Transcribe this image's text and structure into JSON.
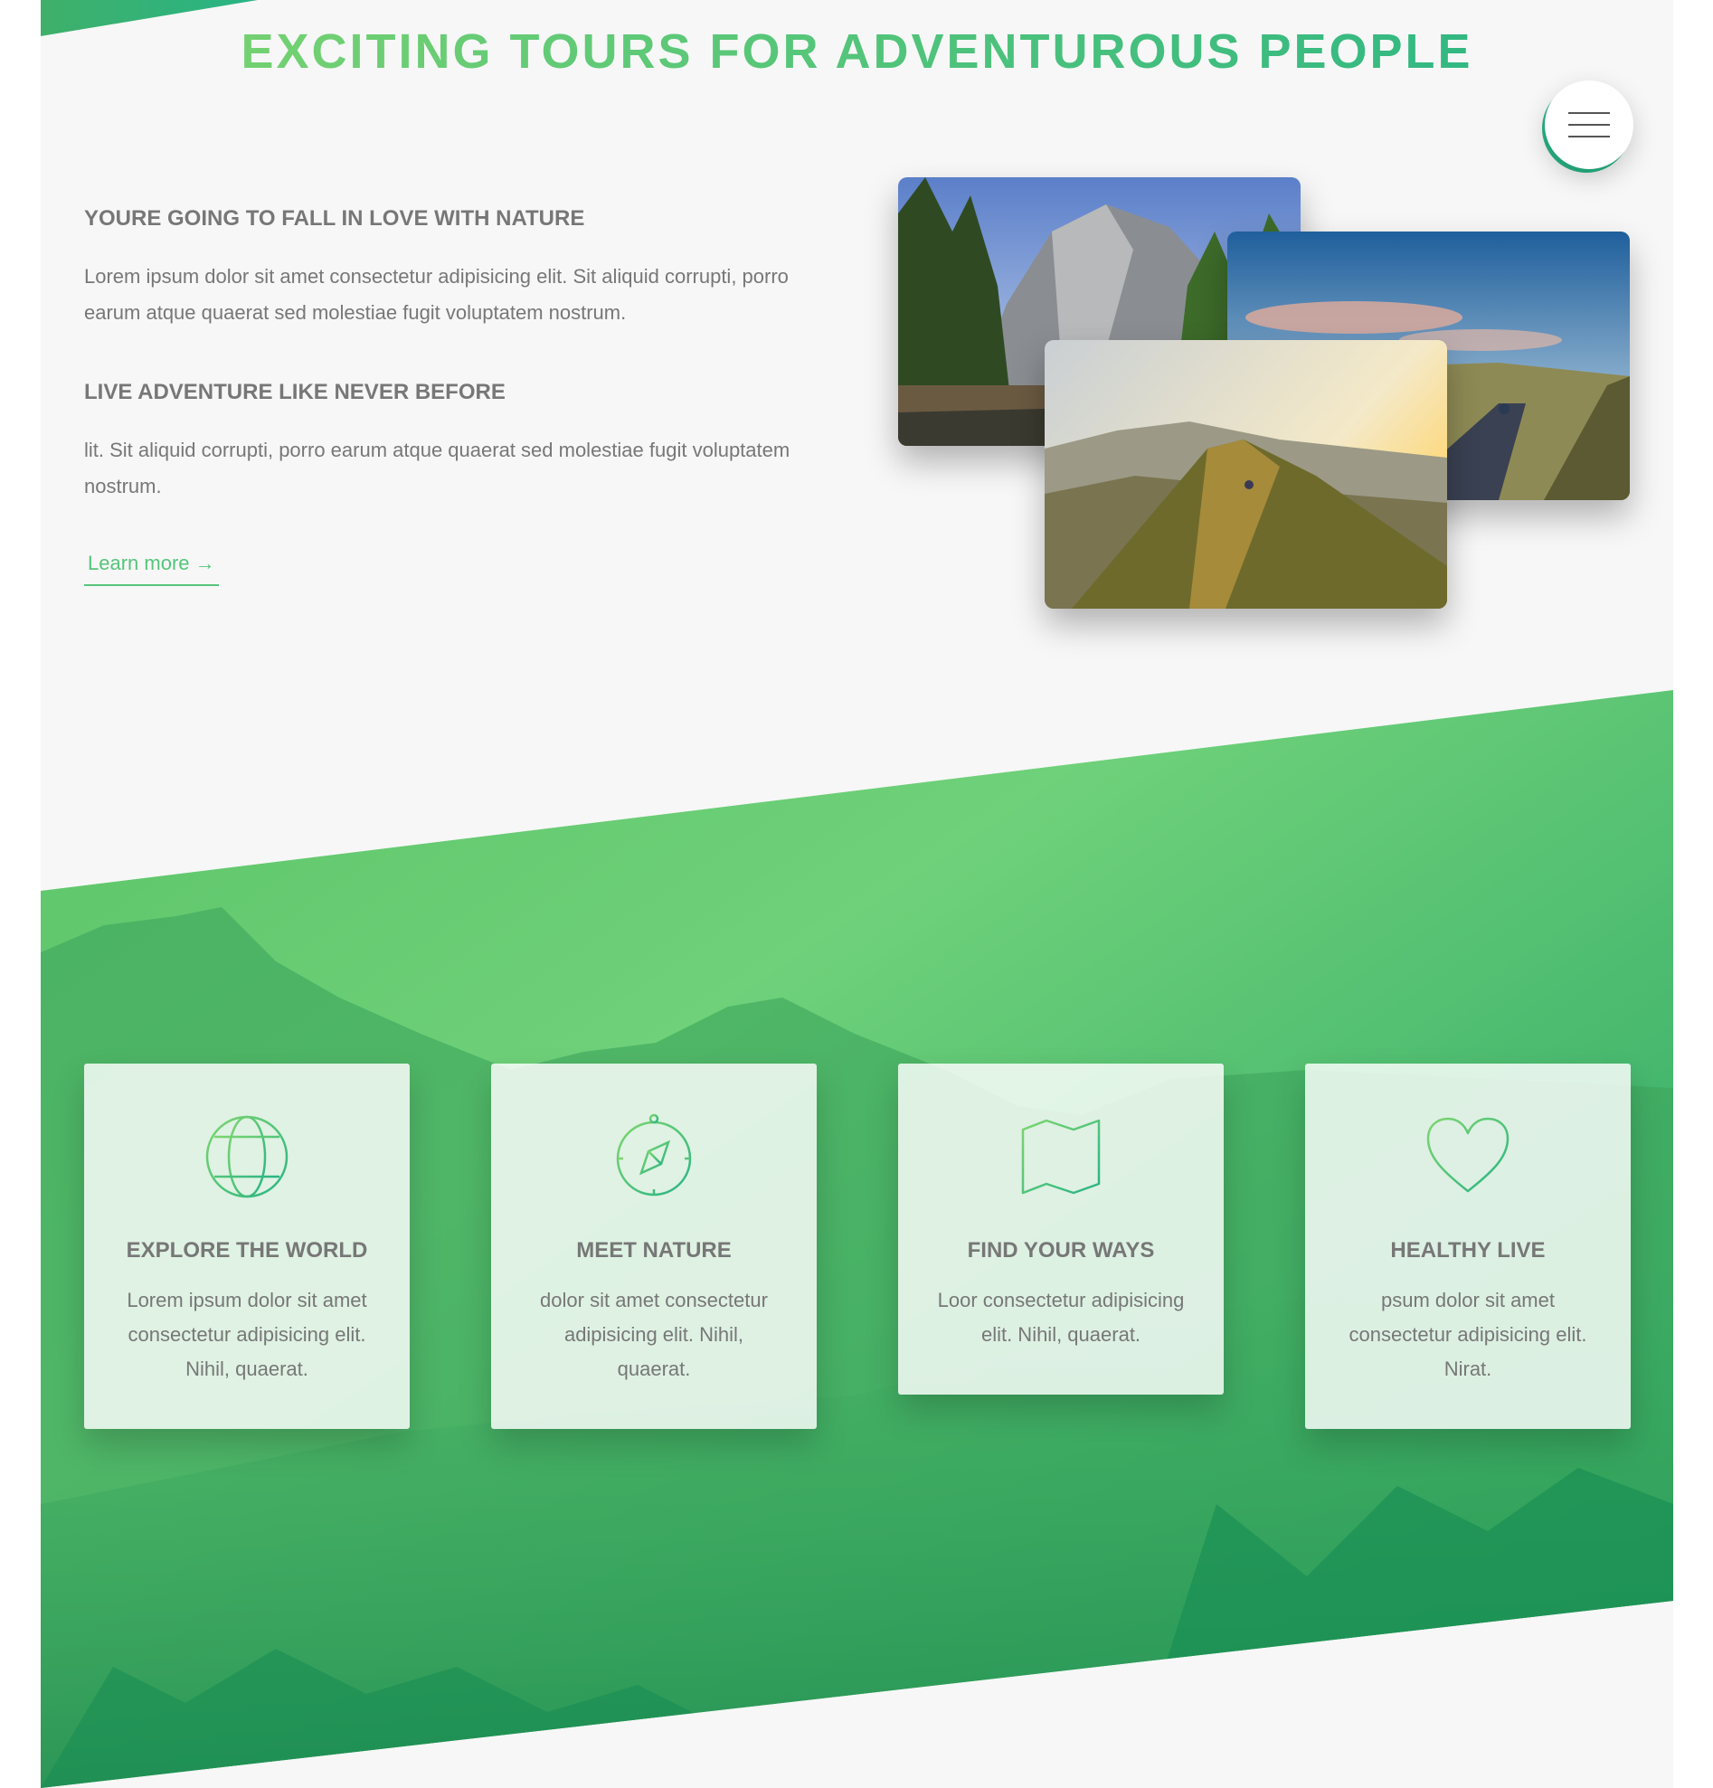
{
  "header": {
    "title": "EXCITING TOURS FOR ADVENTUROUS PEOPLE",
    "menu_icon": "hamburger-menu-icon"
  },
  "about": {
    "heading_1": "YOURE GOING TO FALL IN LOVE WITH NATURE",
    "text_1": "Lorem ipsum dolor sit amet consectetur adipisicing elit. Sit aliquid corrupti, porro earum atque quaerat sed molestiae fugit voluptatem nostrum.",
    "heading_2": "LIVE ADVENTURE LIKE NEVER BEFORE",
    "text_2": "lit. Sit aliquid corrupti, porro earum atque quaerat sed molestiae fugit voluptatem nostrum.",
    "link_label": "Learn more →"
  },
  "features": [
    {
      "icon": "globe-icon",
      "title": "EXPLORE THE WORLD",
      "text": "Lorem ipsum dolor sit amet consectetur adipisicing elit. Nihil, quaerat."
    },
    {
      "icon": "compass-icon",
      "title": "MEET NATURE",
      "text": "dolor sit amet consectetur adipisicing elit. Nihil, quaerat."
    },
    {
      "icon": "map-icon",
      "title": "FIND YOUR WAYS",
      "text": "Loor consectetur adipisicing elit. Nihil, quaerat."
    },
    {
      "icon": "heart-icon",
      "title": "HEALTHY LIVE",
      "text": "psum dolor sit amet consectetur adipisicing elit. Nirat."
    }
  ],
  "colors": {
    "primary_light": "#7ed56f",
    "primary_dark": "#28b485",
    "text_grey": "#777777"
  }
}
